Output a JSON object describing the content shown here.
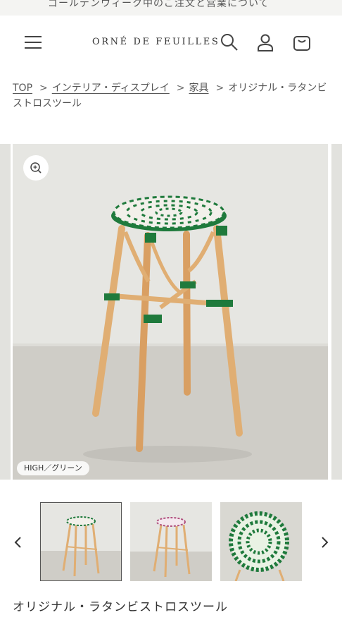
{
  "announcement": {
    "text": "ゴールデンウィーク中のご注文と営業について"
  },
  "header": {
    "logo": "ORNÉ DE FEUILLES",
    "icons": [
      "menu-icon",
      "search-icon",
      "account-icon",
      "cart-icon"
    ]
  },
  "breadcrumb": {
    "items": [
      "TOP",
      "インテリア・ディスプレイ",
      "家具"
    ],
    "current": "オリジナル・ラタンビストロスツール",
    "separator": ">"
  },
  "gallery": {
    "variant_label": "HIGH／グリーン",
    "zoom_icon": "zoom-in-icon"
  },
  "thumbnails": {
    "prev_icon": "chevron-left-icon",
    "next_icon": "chevron-right-icon",
    "selected_index": 0,
    "items": [
      "green-stool",
      "pink-stool",
      "green-seat-top"
    ]
  },
  "product": {
    "title": "オリジナル・ラタンビストロスツール"
  },
  "colors": {
    "stool_green": "#1f7a3c",
    "rattan": "#d9a66b",
    "background": "#ffffff"
  }
}
